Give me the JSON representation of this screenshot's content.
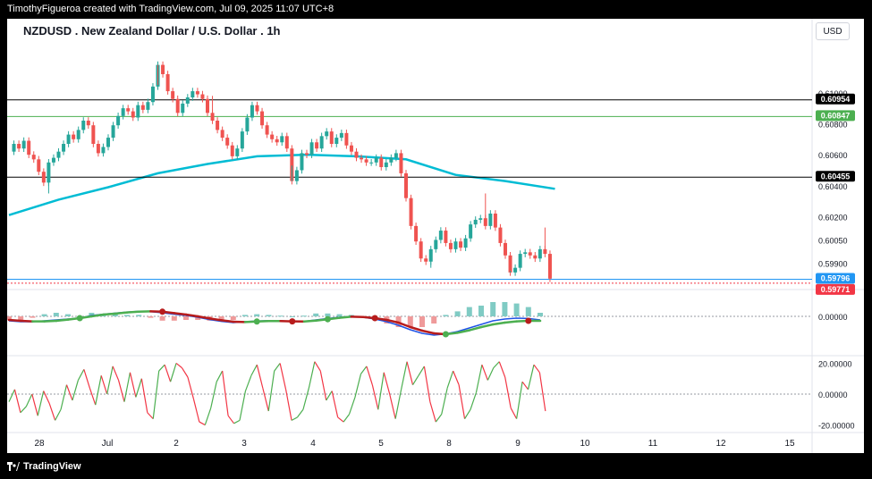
{
  "header": {
    "credit": "TimothyFigueroa created with TradingView.com, Jul 09, 2025 11:07 UTC+8",
    "title": "NZDUSD . New Zealand Dollar / U.S. Dollar . 1h",
    "currency": "USD"
  },
  "footer": {
    "brand": "TradingView"
  },
  "colors": {
    "up": "#26a69a",
    "down": "#ef5350",
    "ma": "#00bcd4",
    "black_line": "#000000",
    "green_line": "#4caf50",
    "blue_line": "#2196f3",
    "red_label": "#f23645",
    "macd_line": "#1e53e5",
    "signal_up": "#4caf50",
    "signal_down": "#b71c1c",
    "osc_up": "#4caf50",
    "osc_down": "#f23645"
  },
  "chart_data": [
    {
      "type": "candlestick",
      "title": "NZDUSD . New Zealand Dollar / U.S. Dollar . 1h",
      "ylim": [
        0.5977,
        0.6127
      ],
      "y_ticks": [
        0.61,
        0.608,
        0.606,
        0.604,
        0.602,
        0.6005,
        0.599
      ],
      "x_ticks": [
        "28",
        "Jul",
        "2",
        "3",
        "4",
        "5",
        "8",
        "9",
        "10",
        "11",
        "12",
        "15"
      ],
      "close_path": [
        0.6062,
        0.6067,
        0.6064,
        0.6069,
        0.606,
        0.6057,
        0.6049,
        0.6042,
        0.6055,
        0.6058,
        0.6062,
        0.6067,
        0.6073,
        0.607,
        0.6076,
        0.6082,
        0.6079,
        0.6067,
        0.6061,
        0.6065,
        0.6071,
        0.6079,
        0.6085,
        0.609,
        0.6088,
        0.6084,
        0.6092,
        0.6089,
        0.6094,
        0.6104,
        0.6118,
        0.6112,
        0.6101,
        0.6096,
        0.6087,
        0.6093,
        0.6097,
        0.6101,
        0.6099,
        0.6096,
        0.6087,
        0.6082,
        0.6076,
        0.6071,
        0.6066,
        0.6059,
        0.6064,
        0.6075,
        0.6084,
        0.6092,
        0.6088,
        0.6079,
        0.6073,
        0.607,
        0.6068,
        0.6072,
        0.6064,
        0.6043,
        0.605,
        0.6061,
        0.606,
        0.6068,
        0.6064,
        0.6072,
        0.6075,
        0.6067,
        0.6071,
        0.6074,
        0.6066,
        0.6062,
        0.6058,
        0.6057,
        0.6055,
        0.6055,
        0.6058,
        0.6052,
        0.6055,
        0.6058,
        0.6061,
        0.6048,
        0.6032,
        0.6014,
        0.6004,
        0.5993,
        0.5991,
        0.5999,
        0.6005,
        0.6011,
        0.6003,
        0.5999,
        0.6004,
        0.6,
        0.6006,
        0.6015,
        0.6018,
        0.6019,
        0.6014,
        0.6022,
        0.6013,
        0.6003,
        0.5995,
        0.5984,
        0.5987,
        0.5996,
        0.5997,
        0.5995,
        0.5993,
        0.5999,
        0.5996,
        0.598
      ],
      "high_spikes": [
        0.6105,
        0.6098,
        0.6035,
        0.6013
      ],
      "low_spikes": [
        0.6035,
        0.6053,
        0.5987,
        0.5985
      ],
      "moving_average": {
        "x_index": [
          0,
          10,
          20,
          30,
          40,
          50,
          60,
          70,
          80,
          90,
          100,
          110
        ],
        "values": [
          0.6021,
          0.6031,
          0.6039,
          0.6048,
          0.6054,
          0.6059,
          0.606,
          0.6059,
          0.6057,
          0.6047,
          0.6043,
          0.6038
        ]
      },
      "horizontal_lines": [
        {
          "name": "resistance-2",
          "value": 0.60954,
          "label": "0.60954",
          "color": "#000000"
        },
        {
          "name": "resistance-1",
          "value": 0.60847,
          "label": "0.60847",
          "color": "#4caf50"
        },
        {
          "name": "support",
          "value": 0.60455,
          "label": "0.60455",
          "color": "#000000"
        },
        {
          "name": "current-level",
          "value": 0.59796,
          "label": "0.59796",
          "color": "#2196f3"
        },
        {
          "name": "last-price",
          "value": 0.59771,
          "label": "0.59771",
          "color": "#f23645"
        }
      ],
      "tick_labels": [
        "0.61000",
        "0.60800",
        "0.60600",
        "0.60400",
        "0.60200",
        "0.60050",
        "0.59900"
      ]
    },
    {
      "type": "macd",
      "zero_label": "0.00000",
      "macd": [
        -0.00025,
        -0.0003,
        -0.0003,
        -0.00025,
        -0.0002,
        -0.00015,
        -0.0001,
        5e-05,
        0.00012,
        0.00018,
        0.00024,
        0.00028,
        0.00026,
        0.0002,
        0.00012,
        5e-05,
        -5e-05,
        -0.00018,
        -0.00028,
        -0.00035,
        -0.0003,
        -0.00026,
        -0.00024,
        -0.00025,
        -0.00028,
        -0.00028,
        -0.0002,
        -0.00012,
        -5e-05,
        0.0,
        -5e-05,
        -0.00015,
        -0.0003,
        -0.0005,
        -0.00075,
        -0.00095,
        -0.00105,
        -0.00098,
        -0.00085,
        -0.00065,
        -0.00045,
        -0.00025,
        -0.00015,
        -0.0001,
        -0.00012,
        -0.0002
      ],
      "signal": [
        -0.0002,
        -0.00025,
        -0.00028,
        -0.00028,
        -0.00025,
        -0.00018,
        -0.0001,
        0.0,
        0.0001,
        0.00015,
        0.00022,
        0.00026,
        0.00028,
        0.00026,
        0.00018,
        0.0001,
        0.0,
        -0.00012,
        -0.00022,
        -0.0003,
        -0.00032,
        -0.00029,
        -0.00026,
        -0.00026,
        -0.00028,
        -0.00029,
        -0.00024,
        -0.00016,
        -8e-05,
        -2e-05,
        -4e-05,
        -0.0001,
        -0.0002,
        -0.00035,
        -0.0006,
        -0.0008,
        -0.00095,
        -0.001,
        -0.00092,
        -0.00078,
        -0.0006,
        -0.00045,
        -0.00035,
        -0.00028,
        -0.00025,
        -0.00025
      ],
      "cross_markers": [
        {
          "index": 6,
          "kind": "bull"
        },
        {
          "index": 13,
          "kind": "bear"
        },
        {
          "index": 21,
          "kind": "bull"
        },
        {
          "index": 24,
          "kind": "bear"
        },
        {
          "index": 27,
          "kind": "bull"
        },
        {
          "index": 31,
          "kind": "bear"
        },
        {
          "index": 37,
          "kind": "bull"
        },
        {
          "index": 44,
          "kind": "bear"
        }
      ]
    },
    {
      "type": "oscillator",
      "y_ticks": [
        "20.00000",
        "0.00000",
        "-20.00000"
      ],
      "ylim": [
        -22,
        22
      ],
      "values": [
        -5,
        3,
        -12,
        -8,
        0,
        -14,
        2,
        -6,
        -17,
        -10,
        6,
        -4,
        9,
        16,
        4,
        -7,
        12,
        0,
        18,
        9,
        -5,
        14,
        -2,
        10,
        -12,
        -16,
        15,
        19,
        8,
        20,
        17,
        11,
        -3,
        -18,
        -20,
        -9,
        8,
        15,
        -14,
        -19,
        -17,
        2,
        12,
        19,
        4,
        -11,
        15,
        20,
        3,
        -17,
        -15,
        -10,
        4,
        21,
        15,
        -4,
        2,
        -15,
        -18,
        -13,
        -2,
        13,
        18,
        6,
        -10,
        14,
        0,
        -16,
        3,
        21,
        6,
        12,
        18,
        -5,
        -18,
        -13,
        4,
        15,
        6,
        -16,
        -10,
        1,
        19,
        9,
        17,
        21,
        11,
        -9,
        -16,
        8,
        3,
        19,
        14,
        -11
      ]
    }
  ]
}
